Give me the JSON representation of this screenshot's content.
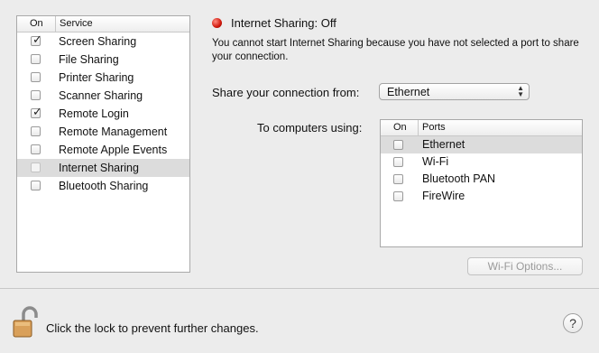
{
  "services_table": {
    "col_on": "On",
    "col_service": "Service",
    "rows": [
      {
        "label": "Screen Sharing",
        "checked": true,
        "selected": false
      },
      {
        "label": "File Sharing",
        "checked": false,
        "selected": false
      },
      {
        "label": "Printer Sharing",
        "checked": false,
        "selected": false
      },
      {
        "label": "Scanner Sharing",
        "checked": false,
        "selected": false
      },
      {
        "label": "Remote Login",
        "checked": true,
        "selected": false
      },
      {
        "label": "Remote Management",
        "checked": false,
        "selected": false
      },
      {
        "label": "Remote Apple Events",
        "checked": false,
        "selected": false
      },
      {
        "label": "Internet Sharing",
        "checked": false,
        "selected": true
      },
      {
        "label": "Bluetooth Sharing",
        "checked": false,
        "selected": false
      }
    ]
  },
  "status": {
    "title": "Internet Sharing: Off",
    "color": "#d0170b",
    "message": "You cannot start Internet Sharing because you have not selected a port to share your connection."
  },
  "share_from": {
    "label": "Share your connection from:",
    "value": "Ethernet"
  },
  "to_computers": {
    "label": "To computers using:",
    "col_on": "On",
    "col_ports": "Ports",
    "ports": [
      {
        "label": "Ethernet",
        "checked": false,
        "selected": true
      },
      {
        "label": "Wi-Fi",
        "checked": false,
        "selected": false
      },
      {
        "label": "Bluetooth PAN",
        "checked": false,
        "selected": false
      },
      {
        "label": "FireWire",
        "checked": false,
        "selected": false
      }
    ]
  },
  "wifi_options_label": "Wi-Fi Options...",
  "footer": {
    "lock_text": "Click the lock to prevent further changes.",
    "lock_icon": "lock-open-icon",
    "help_label": "?"
  }
}
